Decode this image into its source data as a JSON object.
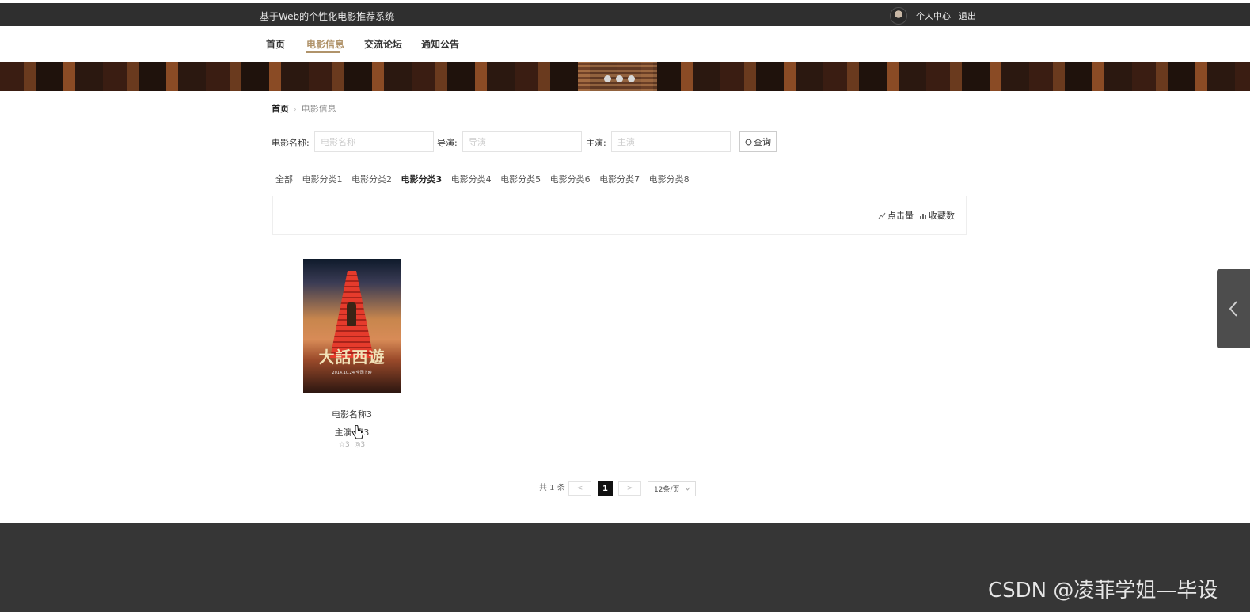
{
  "header": {
    "site_title": "基于Web的个性化电影推荐系统",
    "profile_link": "个人中心",
    "logout_link": "退出"
  },
  "nav": {
    "items": [
      {
        "label": "首页"
      },
      {
        "label": "电影信息",
        "active": true
      },
      {
        "label": "交流论坛"
      },
      {
        "label": "通知公告"
      }
    ]
  },
  "breadcrumb": {
    "home": "首页",
    "separator": "›",
    "current": "电影信息"
  },
  "search": {
    "name_label": "电影名称:",
    "name_placeholder": "电影名称",
    "director_label": "导演:",
    "director_placeholder": "导演",
    "actor_label": "主演:",
    "actor_placeholder": "主演",
    "button_label": "查询"
  },
  "categories": [
    "全部",
    "电影分类1",
    "电影分类2",
    "电影分类3",
    "电影分类4",
    "电影分类5",
    "电影分类6",
    "电影分类7",
    "电影分类8"
  ],
  "active_category": "电影分类3",
  "sort": {
    "clicks": "点击量",
    "favorites": "收藏数"
  },
  "movie": {
    "poster_title": "大話西遊",
    "poster_small": "2014.10.24 全国上映",
    "name": "电影名称3",
    "actor": "主演:演3",
    "fav_count": "3",
    "view_count": "3"
  },
  "pagination": {
    "total": "共 1 条",
    "prev": "<",
    "current": "1",
    "next": ">",
    "page_size": "12条/页"
  },
  "watermark": "CSDN @凌菲学姐—毕设",
  "colors": {
    "topbar": "#2f2f2f",
    "accent": "#b0936a",
    "footer": "#363636"
  }
}
